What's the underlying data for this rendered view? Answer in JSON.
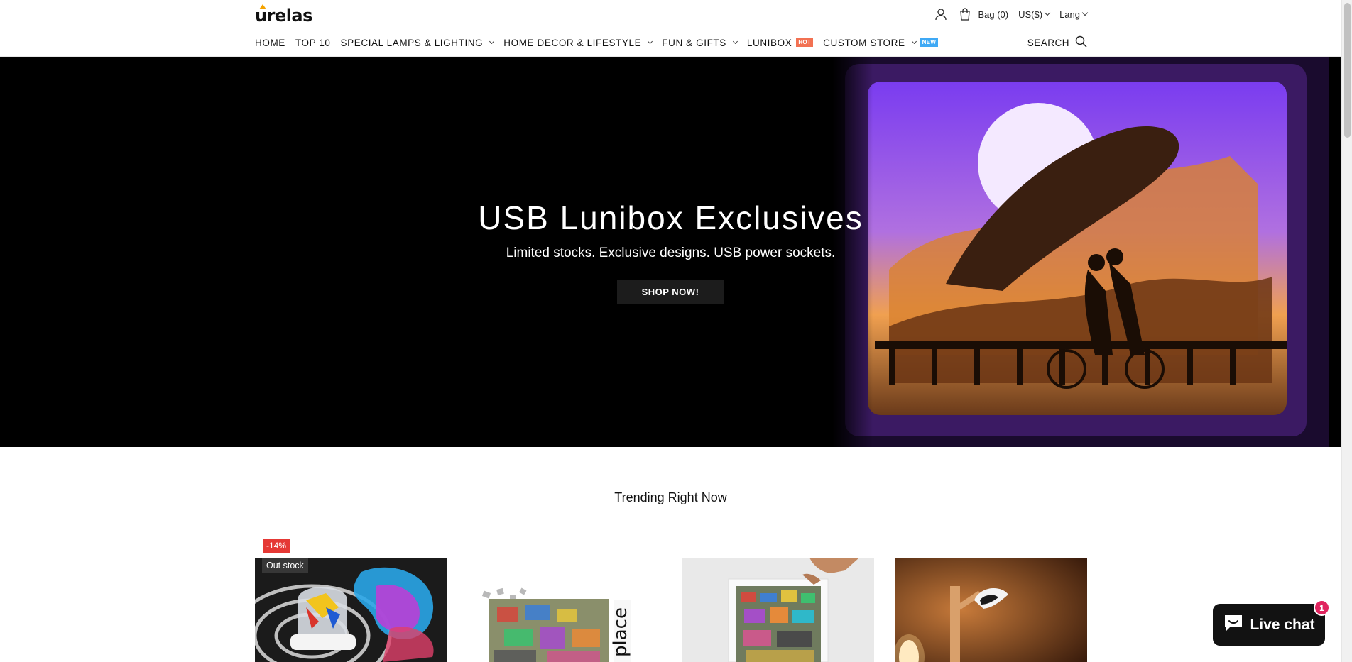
{
  "brand": {
    "name": "urelas"
  },
  "top_bar": {
    "bag_label": "Bag (0)",
    "currency_label": "US($)",
    "language_label": "Lang"
  },
  "nav": {
    "items": [
      {
        "label": "HOME"
      },
      {
        "label": "TOP 10"
      },
      {
        "label": "SPECIAL LAMPS & LIGHTING"
      },
      {
        "label": "HOME DECOR & LIFESTYLE"
      },
      {
        "label": "FUN & GIFTS"
      },
      {
        "label": "LUNIBOX",
        "badge": "HOT"
      },
      {
        "label": "CUSTOM STORE",
        "badge": "NEW"
      }
    ],
    "search_label": "SEARCH"
  },
  "hero": {
    "title": "USB Lunibox Exclusives",
    "subtitle": "Limited stocks. Exclusive designs. USB power sockets.",
    "cta_label": "SHOP NOW!"
  },
  "trending": {
    "title": "Trending Right Now",
    "first_product": {
      "discount_badge": "-14%",
      "stock_badge": "Out stock"
    }
  },
  "live_chat": {
    "label": "Live chat",
    "unread_count": "1"
  },
  "colors": {
    "hot_badge": "#f27152",
    "new_badge": "#3fa9f5",
    "sale_badge": "#e53935",
    "chat_badge": "#e0245e",
    "hero_background": "#000000"
  }
}
